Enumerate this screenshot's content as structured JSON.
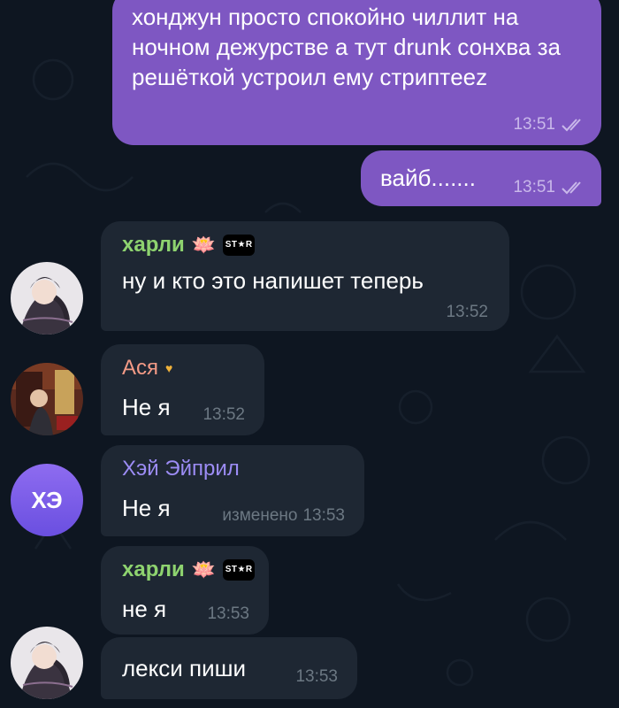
{
  "colors": {
    "background": "#0e1621",
    "outgoing_bubble": "#7e57c2",
    "incoming_bubble": "#1e2733",
    "name_harli": "#8ed36f",
    "name_asya": "#f39a86",
    "name_hey": "#9c8cf5",
    "meta_out": "#c9b8ea",
    "meta_in": "#6c7883"
  },
  "messages": [
    {
      "direction": "out",
      "text": "хонджун просто спокойно чиллит на ночном дежурстве а тут drunk сонхва за решёткой устроил ему стриптeez",
      "time": "13:51",
      "status": "read"
    },
    {
      "direction": "out",
      "text": "вайб.......",
      "time": "13:51",
      "status": "read"
    },
    {
      "direction": "in",
      "sender": "харли",
      "sender_emoji": "🪷",
      "sender_badge": "ST★R",
      "text": "ну и кто это напишет теперь",
      "time": "13:52",
      "avatar": "harli-avatar"
    },
    {
      "direction": "in",
      "sender": "Ася",
      "sender_emoji": "♥",
      "text": "Не я",
      "time": "13:52",
      "avatar": "asya-avatar"
    },
    {
      "direction": "in",
      "sender": "Хэй Эйприл",
      "text": "Не я",
      "edited_label": "изменено",
      "time": "13:53",
      "avatar_initials": "ХЭ"
    },
    {
      "direction": "in",
      "sender": "харли",
      "sender_emoji": "🪷",
      "sender_badge": "ST★R",
      "text": "не я",
      "time": "13:53"
    },
    {
      "direction": "in",
      "text": "лекси пиши",
      "time": "13:53",
      "avatar": "harli-avatar"
    }
  ]
}
